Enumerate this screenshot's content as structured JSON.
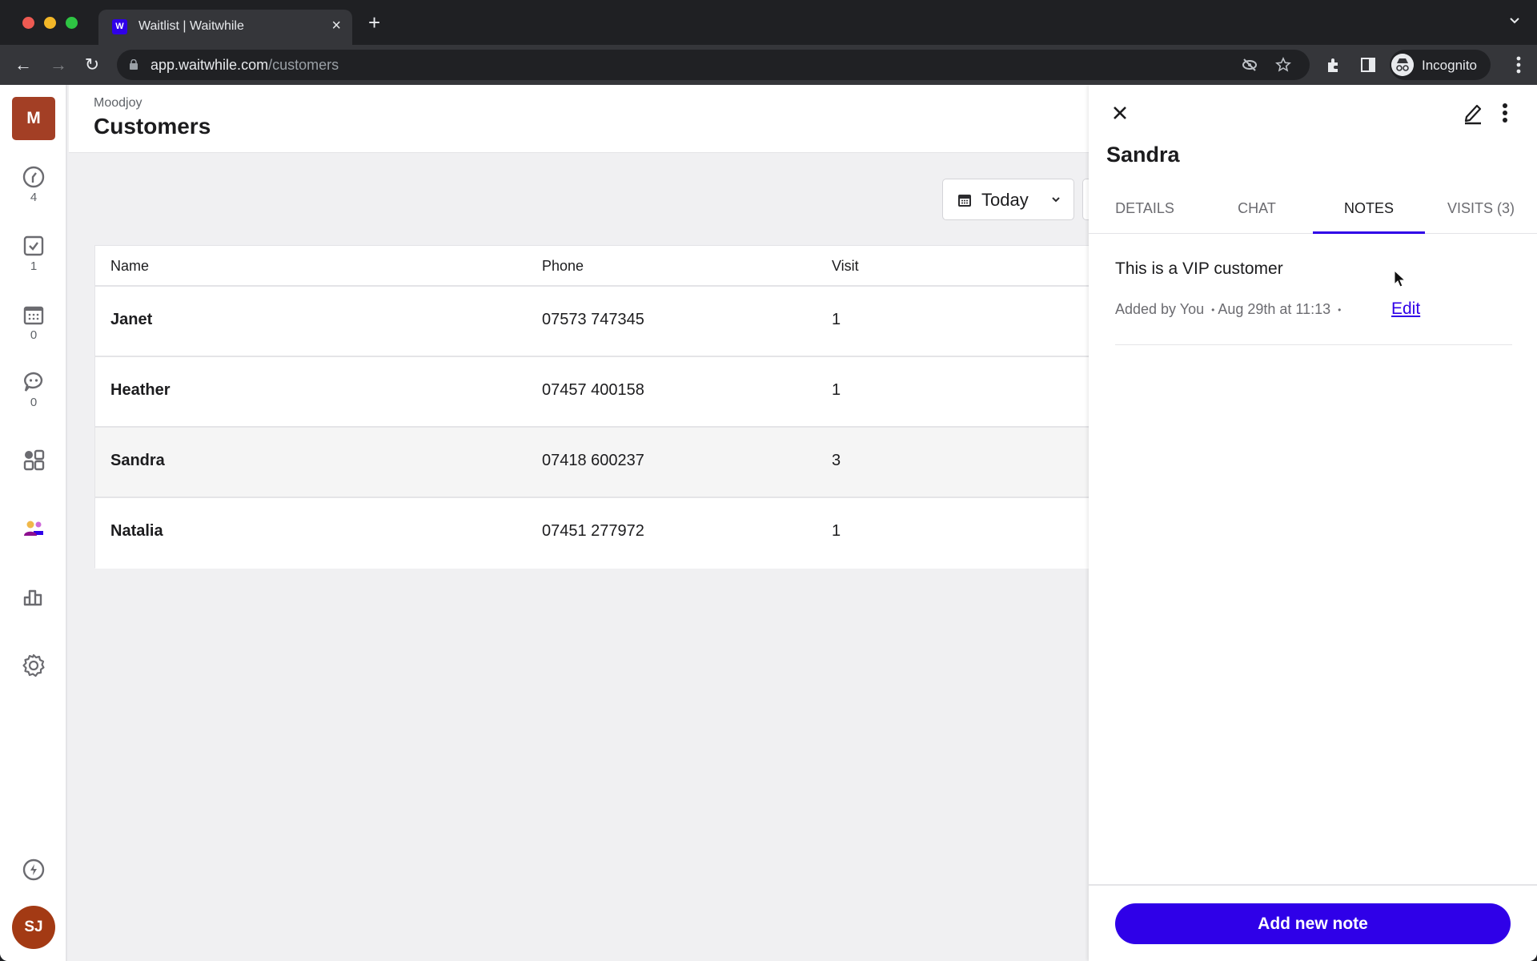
{
  "browser": {
    "tab_title": "Waitlist | Waitwhile",
    "favicon_letter": "W",
    "url_host": "app.waitwhile.com",
    "url_path": "/customers",
    "profile_label": "Incognito",
    "icons": [
      "back-arrow",
      "forward-arrow",
      "reload",
      "lock",
      "eye-off",
      "star",
      "puzzle-extensions",
      "side-panel",
      "incognito",
      "kebab-menu",
      "tab-list-chevron"
    ]
  },
  "rail": {
    "org_initial": "M",
    "items": [
      {
        "name": "waitlist",
        "icon": "clock-icon",
        "count": "4"
      },
      {
        "name": "serving",
        "icon": "checkbox-icon",
        "count": "1"
      },
      {
        "name": "bookings",
        "icon": "calendar-icon",
        "count": "0"
      },
      {
        "name": "messages",
        "icon": "chat-bubble-icon",
        "count": "0"
      },
      {
        "name": "apps",
        "icon": "apps-grid-icon",
        "count": ""
      },
      {
        "name": "customers",
        "icon": "customers-icon",
        "count": "",
        "active": true
      },
      {
        "name": "analytics",
        "icon": "bar-chart-icon",
        "count": ""
      },
      {
        "name": "settings",
        "icon": "gear-icon",
        "count": ""
      },
      {
        "name": "whats-new",
        "icon": "lightning-icon",
        "count": ""
      }
    ],
    "user_initials": "SJ"
  },
  "header": {
    "org_name": "Moodjoy",
    "title": "Customers"
  },
  "filters": {
    "date_label": "Today"
  },
  "table": {
    "columns": [
      "Name",
      "Phone",
      "Visit"
    ],
    "rows": [
      {
        "name": "Janet",
        "phone": "07573 747345",
        "visits": "1"
      },
      {
        "name": "Heather",
        "phone": "07457 400158",
        "visits": "1"
      },
      {
        "name": "Sandra",
        "phone": "07418 600237",
        "visits": "3",
        "selected": true
      },
      {
        "name": "Natalia",
        "phone": "07451 277972",
        "visits": "1"
      }
    ]
  },
  "drawer": {
    "customer_name": "Sandra",
    "tabs": [
      {
        "label": "DETAILS",
        "active": false
      },
      {
        "label": "CHAT",
        "active": false
      },
      {
        "label": "NOTES",
        "active": true
      },
      {
        "label": "VISITS (3)",
        "active": false
      }
    ],
    "notes": [
      {
        "text": "This is a VIP customer",
        "author": "Added by You",
        "timestamp": "Aug 29th at 11:13",
        "edit_label": "Edit"
      }
    ],
    "add_note_label": "Add new note"
  },
  "colors": {
    "accent": "#2f00e8",
    "org_badge": "#a33f25",
    "user_avatar": "#a33a14"
  }
}
